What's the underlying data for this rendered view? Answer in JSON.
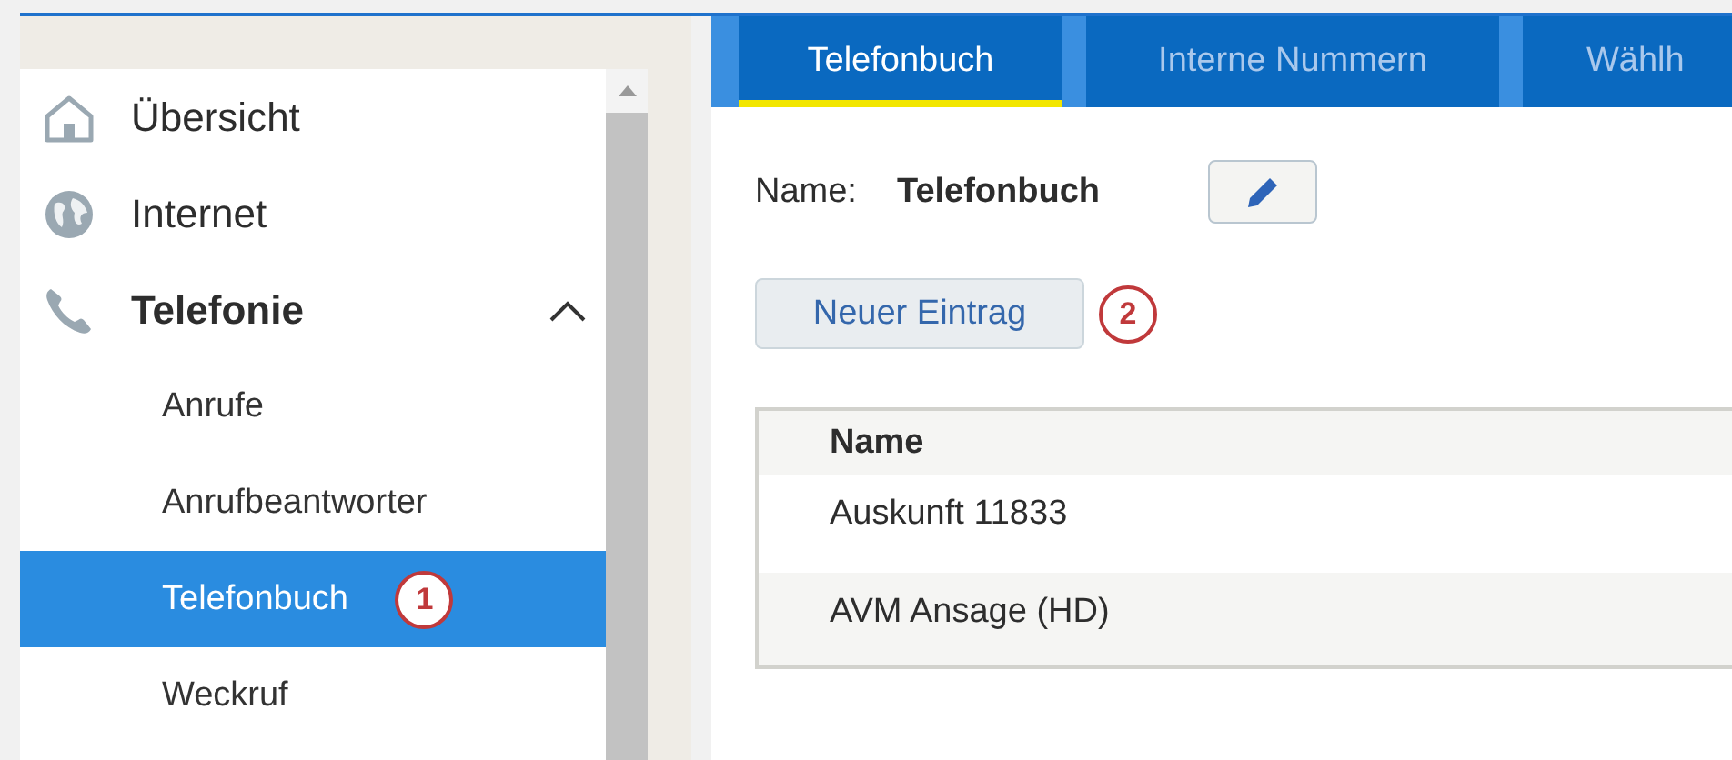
{
  "sidebar": {
    "items": [
      {
        "label": "Übersicht",
        "expanded": false
      },
      {
        "label": "Internet",
        "expanded": false
      },
      {
        "label": "Telefonie",
        "expanded": true,
        "children": [
          {
            "label": "Anrufe",
            "selected": false
          },
          {
            "label": "Anrufbeantworter",
            "selected": false
          },
          {
            "label": "Telefonbuch",
            "selected": true,
            "badge": "1"
          },
          {
            "label": "Weckruf",
            "selected": false
          }
        ]
      }
    ]
  },
  "tabs": [
    {
      "label": "Telefonbuch",
      "selected": true
    },
    {
      "label": "Interne Nummern",
      "selected": false
    },
    {
      "label": "Wählh",
      "selected": false
    }
  ],
  "phonebook": {
    "name_label": "Name:",
    "name_value": "Telefonbuch",
    "new_entry_button": "Neuer Eintrag",
    "new_entry_badge": "2"
  },
  "table": {
    "columns": [
      "Name"
    ],
    "rows": [
      [
        "Auskunft 11833"
      ],
      [
        "AVM Ansage (HD)"
      ]
    ]
  }
}
